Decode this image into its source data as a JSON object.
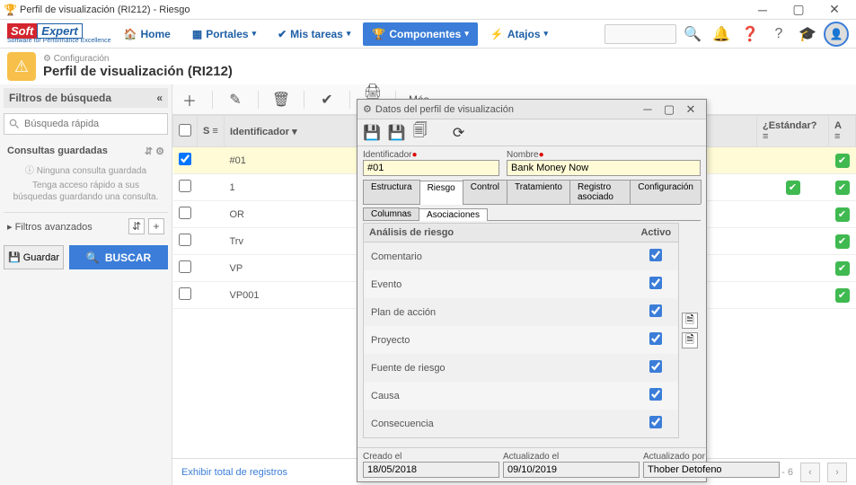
{
  "window": {
    "title": "Perfil de visualización (RI212) - Riesgo"
  },
  "nav": {
    "home": "Home",
    "portales": "Portales",
    "tareas": "Mis tareas",
    "componentes": "Componentes",
    "atajos": "Atajos"
  },
  "header": {
    "breadcrumb": "Configuración",
    "title": "Perfil de visualización (RI212)"
  },
  "sidebar": {
    "filters_title": "Filtros de búsqueda",
    "quicksearch_placeholder": "Búsqueda rápida",
    "saved_title": "Consultas guardadas",
    "saved_none": "Ninguna consulta guardada",
    "saved_tip": "Tenga acceso rápido a sus búsquedas guardando una consulta.",
    "adv_filters": "Filtros avanzados",
    "save_btn": "Guardar",
    "search_btn": "BUSCAR"
  },
  "toolbar": {
    "more": "Más"
  },
  "table": {
    "columns": {
      "s": "S",
      "id": "Identificador",
      "standard": "¿Estándar?",
      "a": "A"
    },
    "rows": [
      {
        "checked": true,
        "id": "#01",
        "standard": false,
        "a": true
      },
      {
        "checked": false,
        "id": "1",
        "standard": true,
        "a": true
      },
      {
        "checked": false,
        "id": "OR",
        "standard": false,
        "a": true
      },
      {
        "checked": false,
        "id": "Trv",
        "standard": false,
        "a": true
      },
      {
        "checked": false,
        "id": "VP",
        "standard": false,
        "a": true
      },
      {
        "checked": false,
        "id": "VP001",
        "standard": false,
        "a": true
      }
    ]
  },
  "footer": {
    "show_all": "Exhibir total de registros",
    "range": "1 - 6"
  },
  "dialog": {
    "title": "Datos del perfil de visualización",
    "id_label": "Identificador",
    "id_value": "#01",
    "name_label": "Nombre",
    "name_value": "Bank Money Now",
    "tabs1": [
      "Estructura",
      "Riesgo",
      "Control",
      "Tratamiento",
      "Registro asociado",
      "Configuración"
    ],
    "active_tab1": "Riesgo",
    "tabs2": [
      "Columnas",
      "Asociaciones"
    ],
    "active_tab2": "Asociaciones",
    "assoc_header_name": "Análisis de riesgo",
    "assoc_header_active": "Activo",
    "assoc_rows": [
      {
        "name": "Comentario",
        "active": true
      },
      {
        "name": "Evento",
        "active": true
      },
      {
        "name": "Plan de acción",
        "active": true
      },
      {
        "name": "Proyecto",
        "active": true
      },
      {
        "name": "Fuente de riesgo",
        "active": true
      },
      {
        "name": "Causa",
        "active": true
      },
      {
        "name": "Consecuencia",
        "active": true
      }
    ],
    "created_label": "Creado el",
    "created_value": "18/05/2018",
    "updated_label": "Actualizado el",
    "updated_value": "09/10/2019",
    "updated_by_label": "Actualizado por",
    "updated_by_value": "Thober Detofeno"
  }
}
